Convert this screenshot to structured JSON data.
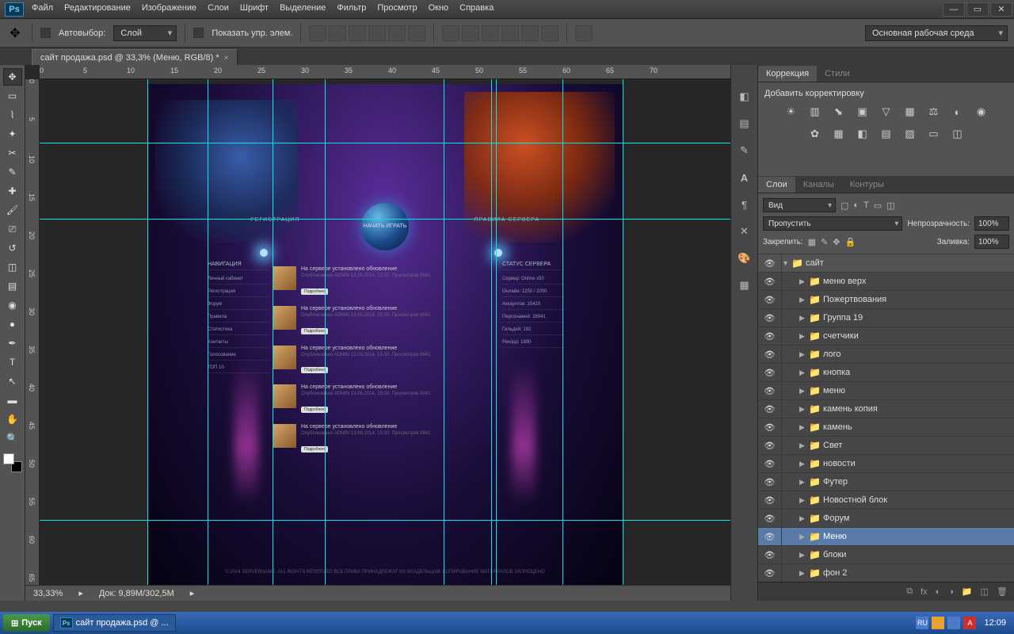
{
  "menubar": [
    "Файл",
    "Редактирование",
    "Изображение",
    "Слои",
    "Шрифт",
    "Выделение",
    "Фильтр",
    "Просмотр",
    "Окно",
    "Справка"
  ],
  "optbar": {
    "autoselect": "Автовыбор:",
    "layer_mode": "Слой",
    "show_controls": "Показать упр. элем.",
    "workspace": "Основная рабочая среда"
  },
  "doctab": "сайт продажа.psd @ 33,3% (Меню, RGB/8) *",
  "rulers_h": [
    "0",
    "5",
    "10",
    "15",
    "20",
    "25",
    "30",
    "35",
    "40",
    "45",
    "50",
    "55",
    "60",
    "65",
    "70"
  ],
  "rulers_v": [
    "0",
    "5",
    "10",
    "15",
    "20",
    "25",
    "30",
    "35",
    "40",
    "45",
    "50",
    "55",
    "60",
    "65"
  ],
  "canvas": {
    "orb": "НАЧАТЬ\nИГРАТЬ",
    "nav_l": "РЕГИСТРАЦИЯ",
    "nav_r": "ПРАВИЛА СЕРВЕРА",
    "side_l_head": "НАВИГАЦИЯ",
    "side_l": [
      "Личный кабинет",
      "Регистрация",
      "Форум",
      "Правила",
      "Статистика",
      "Контакты",
      "Голосование",
      "ТОП 10"
    ],
    "side_r_head": "СТАТУС СЕРВЕРА",
    "side_r": [
      "Сервер: Online x50",
      "Онлайн: 1250 / 2000",
      "Аккаунтов: 15420",
      "Персонажей: 28941",
      "Гильдий: 182",
      "Рекорд: 1890"
    ],
    "news": [
      {
        "t": "На сервере установлено обновление",
        "b": "Опубликовано ADMIN 13.06.2014, 15:30. Просмотров 8841"
      },
      {
        "t": "На сервере установлено обновление",
        "b": "Опубликовано ADMIN 13.06.2014, 15:30. Просмотров 8841"
      },
      {
        "t": "На сервере установлено обновление",
        "b": "Опубликовано ADMIN 13.06.2014, 15:30. Просмотров 8841"
      },
      {
        "t": "На сервере установлено обновление",
        "b": "Опубликовано ADMIN 13.06.2014, 15:30. Просмотров 8841"
      },
      {
        "t": "На сервере установлено обновление",
        "b": "Опубликовано ADMIN 13.06.2014, 15:30. Просмотров 8841"
      }
    ],
    "news_btn": "Подробнее",
    "footer": "© 2014 SERVERNAME. ALL RIGHTS RESERVED\nВСЕ ПРАВА ПРИНАДЛЕЖАТ ИХ ВЛАДЕЛЬЦАМ. КОПИРОВАНИЕ МАТЕРИАЛОВ ЗАПРЕЩЕНО"
  },
  "statusbar": {
    "zoom": "33,33%",
    "doc": "Док: 9,89M/302,5M"
  },
  "panels": {
    "corr_tabs": [
      "Коррекция",
      "Стили"
    ],
    "corr_title": "Добавить корректировку",
    "layer_tabs": [
      "Слои",
      "Каналы",
      "Контуры"
    ],
    "filter": "Вид",
    "blend": "Пропустить",
    "opacity_lbl": "Непрозрачность:",
    "opacity_val": "100%",
    "lock_lbl": "Закрепить:",
    "fill_lbl": "Заливка:",
    "fill_val": "100%",
    "root": "сайт",
    "layers": [
      "меню верх",
      "Пожертвования",
      "Группа 19",
      "счетчики",
      "лого",
      "кнопка",
      "меню",
      "камень копия",
      "камень",
      "Свет",
      "новости",
      "Футер",
      "Новостной блок",
      "Форум",
      "Меню",
      "блоки",
      "фон 2"
    ],
    "selected_index": 14
  },
  "taskbar": {
    "start": "Пуск",
    "item": "сайт продажа.psd @ ...",
    "lang": "RU",
    "time": "12:09"
  }
}
